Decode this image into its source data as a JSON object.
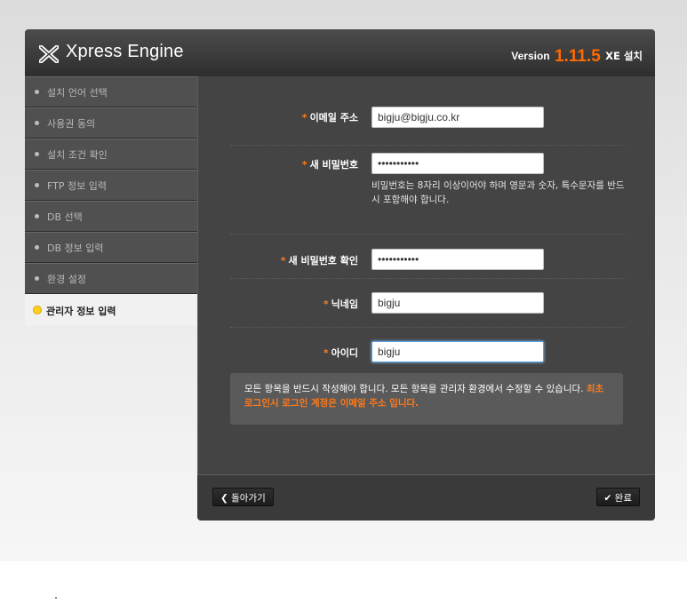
{
  "header": {
    "logo_text": "Xpress Engine",
    "version_prefix": "Version",
    "version_number": "1.11.5",
    "version_suffix": "XE 설치"
  },
  "sidebar": {
    "items": [
      {
        "label": "설치 언어 선택",
        "active": false
      },
      {
        "label": "사용권 동의",
        "active": false
      },
      {
        "label": "설치 조건 확인",
        "active": false
      },
      {
        "label": "FTP 정보 입력",
        "active": false
      },
      {
        "label": "DB 선택",
        "active": false
      },
      {
        "label": "DB 정보 입력",
        "active": false
      },
      {
        "label": "환경 설정",
        "active": false
      },
      {
        "label": "관리자 정보 입력",
        "active": true
      }
    ]
  },
  "form": {
    "required_mark": "*",
    "email": {
      "label": "이메일 주소",
      "value": "bigju@bigju.co.kr"
    },
    "password": {
      "label": "새 비밀번호",
      "value": "•••••••••••",
      "help": "비밀번호는 8자리 이상이어야 하며 영문과 숫자, 특수문자를 반드시 포함해야 합니다."
    },
    "password_confirm": {
      "label": "새 비밀번호 확인",
      "value": "•••••••••••"
    },
    "nickname": {
      "label": "닉네임",
      "value": "bigju"
    },
    "user_id": {
      "label": "아이디",
      "value": "bigju"
    }
  },
  "notice": {
    "text": "모든 항목을 반드시 작성해야 합니다. 모든 항목을 관리자 환경에서 수정할 수 있습니다. ",
    "emphasis": "최초 로그인시 로그인 계정은 이메일 주소 입니다."
  },
  "footer": {
    "back_label": "❮ 돌아가기",
    "done_label": "✔ 완료"
  },
  "colors": {
    "accent": "#ff6a00",
    "active_dot": "#ffd21a",
    "panel": "#444444"
  }
}
